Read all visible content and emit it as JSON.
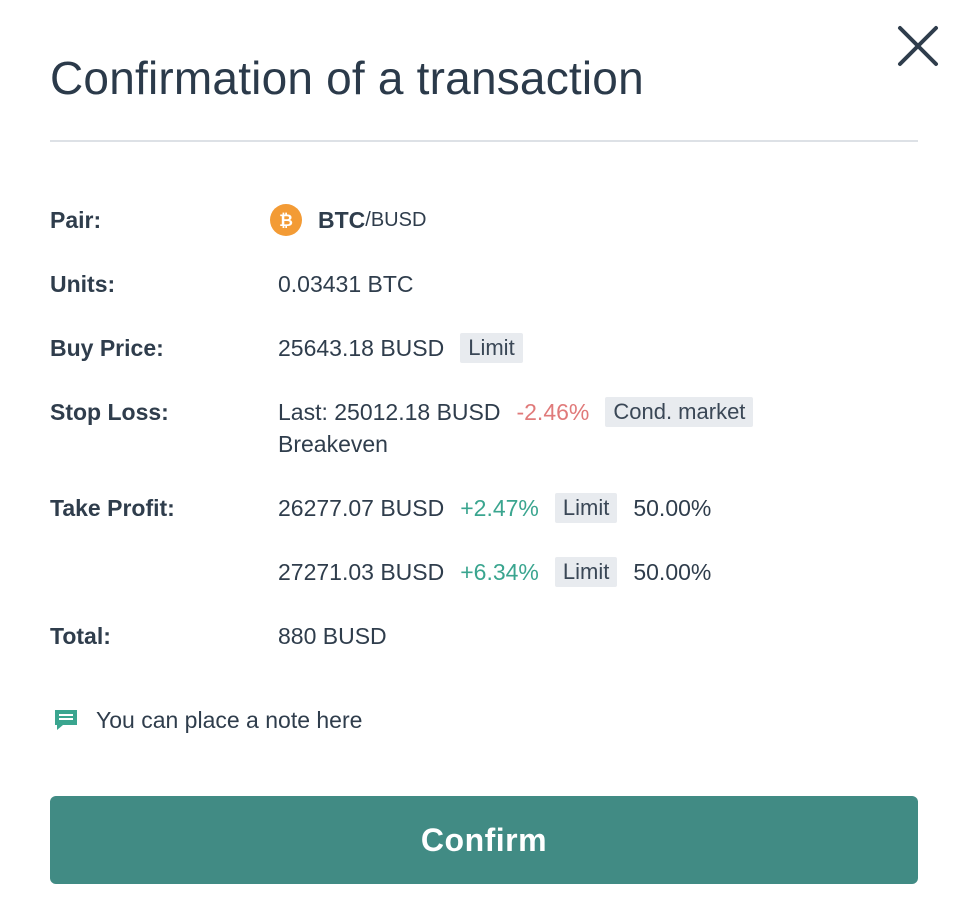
{
  "dialog": {
    "title": "Confirmation of a transaction"
  },
  "pair": {
    "label": "Pair:",
    "icon": "bitcoin-icon",
    "base": "BTC",
    "quote": "/BUSD"
  },
  "units": {
    "label": "Units:",
    "value": "0.03431 BTC"
  },
  "buy_price": {
    "label": "Buy Price:",
    "value": "25643.18 BUSD",
    "type": "Limit"
  },
  "stop_loss": {
    "label": "Stop Loss:",
    "value": "Last: 25012.18 BUSD",
    "change": "-2.46%",
    "type": "Cond. market",
    "mode": "Breakeven"
  },
  "take_profit": {
    "label": "Take Profit:",
    "targets": [
      {
        "price": "26277.07 BUSD",
        "change": "+2.47%",
        "type": "Limit",
        "share": "50.00%"
      },
      {
        "price": "27271.03 BUSD",
        "change": "+6.34%",
        "type": "Limit",
        "share": "50.00%"
      }
    ]
  },
  "total": {
    "label": "Total:",
    "value": "880 BUSD"
  },
  "note": {
    "icon": "comment-icon",
    "text": "You can place a note here"
  },
  "actions": {
    "confirm_label": "Confirm"
  },
  "colors": {
    "accent": "#418b84",
    "positive": "#3aa58f",
    "negative": "#e07a7a",
    "bitcoin": "#f39b35"
  }
}
